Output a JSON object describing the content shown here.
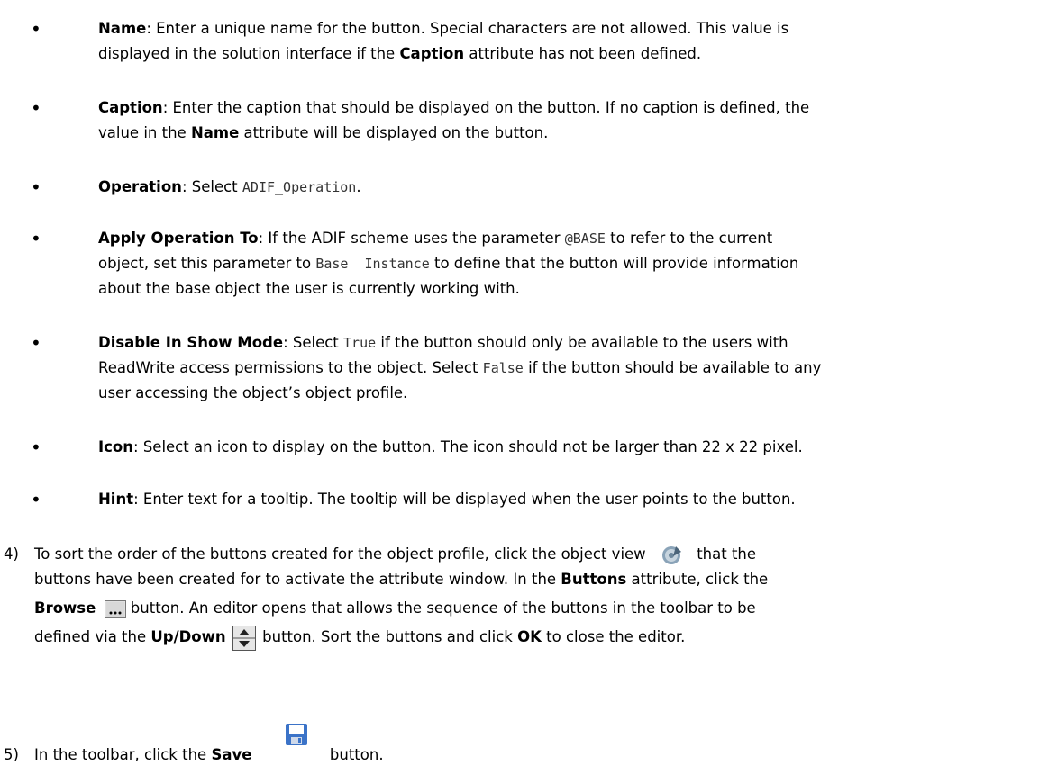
{
  "bullets": [
    {
      "term": "Name",
      "text_a": ": Enter a unique name for the button. Special characters are not allowed. This value is",
      "text_b": "displayed in the solution interface if the ",
      "bold2": "Caption",
      "text_c": " attribute has not been defined."
    },
    {
      "term": "Caption",
      "text_a": ": Enter the caption that should be displayed on the button. If no caption is defined, the",
      "text_b": "value in the ",
      "bold2": "Name",
      "text_c": " attribute will be displayed on the button."
    },
    {
      "term": "Operation",
      "text_a": ": Select ",
      "code": "ADIF_Operation",
      "text_b": "."
    },
    {
      "term": "Apply Operation To",
      "text_a": ": If the ADIF scheme uses the parameter ",
      "code": "@BASE",
      "text_b": " to refer to the current",
      "line2a": "object, set this parameter to ",
      "code2": "Base  Instance",
      "line2b": " to define that the button will provide information",
      "line3": "about the base object the user is currently working with."
    },
    {
      "term": "Disable In Show Mode",
      "text_a": ": Select ",
      "code": "True",
      "text_b": " if the button should only be available to the users with",
      "line2a": "ReadWrite access permissions to the object. Select ",
      "code2": "False",
      "line2b": " if the button should be available to any",
      "line3": "user accessing the object’s object profile."
    },
    {
      "term": "Icon",
      "text_a": ": Select an icon to display on the button. The icon should not be larger than 22 x 22 pixel."
    },
    {
      "term": "Hint",
      "text_a": ": Enter text for a tooltip. The tooltip will be displayed when the user points to the button."
    }
  ],
  "step4": {
    "num": "4)",
    "l1a": "To sort the order of the buttons created for the object profile, click the object view",
    "l1b": "that the",
    "l2a": "buttons have been created for to activate the attribute window. In the ",
    "l2bold": "Buttons",
    "l2b": " attribute, click the",
    "l3bold": "Browse",
    "l3b": " button. An editor opens that allows the sequence of the buttons in the toolbar to be",
    "l4a": "defined via the ",
    "l4bold": "Up/Down",
    "l4b": " button. Sort the buttons and click ",
    "l4bold2": "OK",
    "l4c": " to close the editor."
  },
  "step5": {
    "num": "5)",
    "a": "In the toolbar, click the ",
    "bold": "Save",
    "b": "button."
  },
  "icons": [
    "object-view-icon",
    "browse-icon",
    "up-down-icon",
    "save-icon"
  ]
}
